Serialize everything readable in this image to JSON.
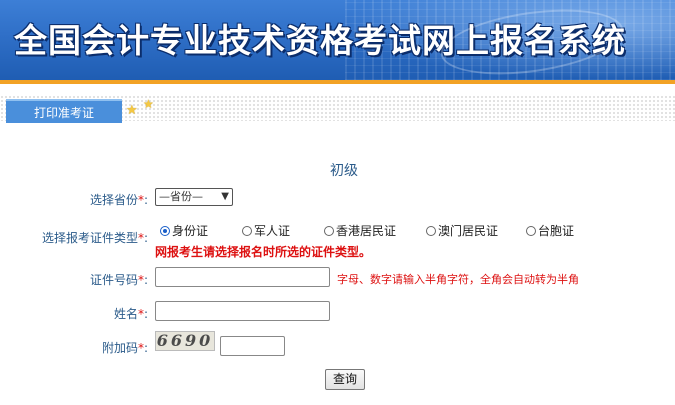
{
  "header": {
    "title": "全国会计专业技术资格考试网上报名系统"
  },
  "tabs": {
    "active_label": "打印准考证"
  },
  "form": {
    "level_heading": "初级",
    "province": {
      "label": "选择省份",
      "required_mark": "*",
      "colon": ":",
      "selected": "—省份—"
    },
    "id_type": {
      "label": "选择报考证件类型",
      "required_mark": "*",
      "colon": ":",
      "options": [
        "身份证",
        "军人证",
        "香港居民证",
        "澳门居民证",
        "台胞证"
      ],
      "selected": "身份证",
      "note": "网报考生请选择报名时所选的证件类型。"
    },
    "id_number": {
      "label": "证件号码",
      "required_mark": "*",
      "colon": ":",
      "value": "",
      "hint": "字母、数字请输入半角字符，全角会自动转为半角"
    },
    "name": {
      "label": "姓名",
      "required_mark": "*",
      "colon": ":",
      "value": ""
    },
    "captcha": {
      "label": "附加码",
      "required_mark": "*",
      "colon": ":",
      "image_text": "6690",
      "value": ""
    },
    "submit_label": "查询"
  },
  "colors": {
    "banner_blue": "#2f6fc7",
    "accent_orange": "#f2a225",
    "label_blue": "#2b5b8a",
    "required_red": "#dd1111"
  }
}
